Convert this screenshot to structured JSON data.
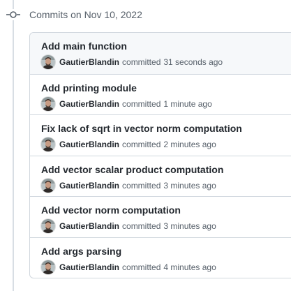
{
  "group": {
    "title": "Commits on Nov 10, 2022",
    "icon": "git-commit-icon"
  },
  "commits": [
    {
      "title": "Add main function",
      "author": "GautierBlandin",
      "verb": "committed",
      "time": "31 seconds ago"
    },
    {
      "title": "Add printing module",
      "author": "GautierBlandin",
      "verb": "committed",
      "time": "1 minute ago"
    },
    {
      "title": "Fix lack of sqrt in vector norm computation",
      "author": "GautierBlandin",
      "verb": "committed",
      "time": "2 minutes ago"
    },
    {
      "title": "Add vector scalar product computation",
      "author": "GautierBlandin",
      "verb": "committed",
      "time": "3 minutes ago"
    },
    {
      "title": "Add vector norm computation",
      "author": "GautierBlandin",
      "verb": "committed",
      "time": "3 minutes ago"
    },
    {
      "title": "Add args parsing",
      "author": "GautierBlandin",
      "verb": "committed",
      "time": "4 minutes ago"
    }
  ],
  "colors": {
    "border": "#d0d7de",
    "muted_text": "#57606a",
    "primary_text": "#24292f",
    "highlight_row": "#f6f8fa"
  }
}
